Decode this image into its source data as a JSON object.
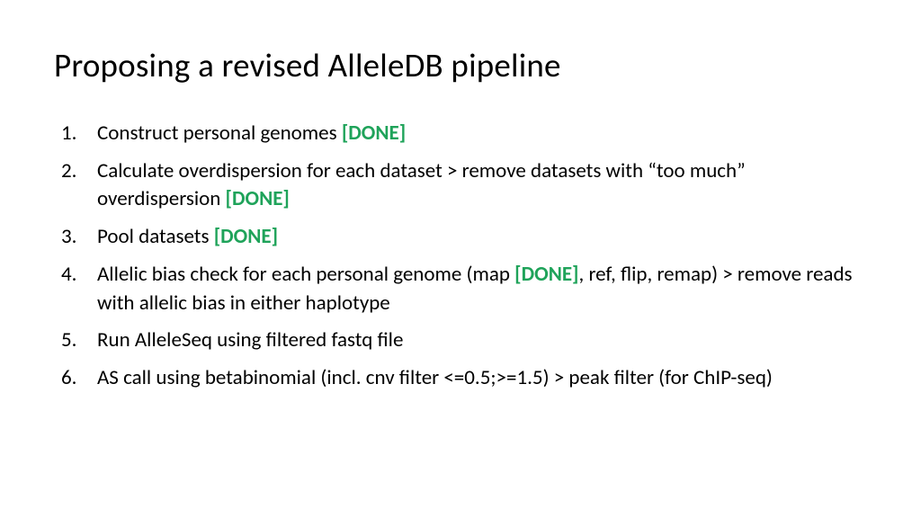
{
  "title": "Proposing a revised AlleleDB pipeline",
  "done_label": "[DONE]",
  "items": {
    "i1": {
      "text": "Construct personal genomes "
    },
    "i2": {
      "pre": "Calculate overdispersion for each dataset > remove datasets with “too much” overdispersion "
    },
    "i3": {
      "pre": "Pool datasets "
    },
    "i4": {
      "pre": "Allelic bias check for each personal genome (map ",
      "post": ", ref, flip, remap) > remove reads with allelic bias in either haplotype"
    },
    "i5": {
      "text": "Run AlleleSeq using filtered fastq file"
    },
    "i6": {
      "text": "AS call using betabinomial (incl. cnv filter <=0.5;>=1.5) > peak filter (for ChIP-seq)"
    }
  }
}
